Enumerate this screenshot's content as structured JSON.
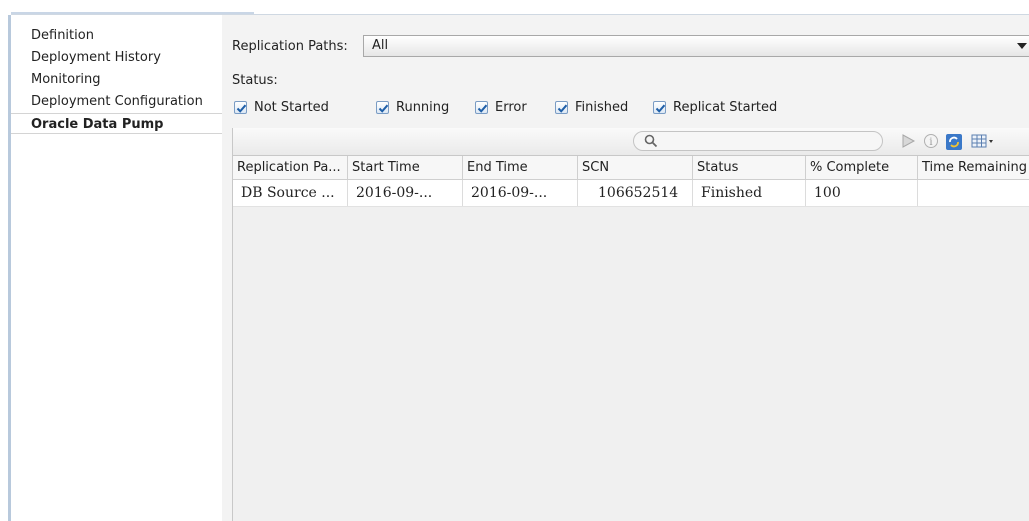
{
  "sidebar": {
    "items": [
      {
        "label": "Definition"
      },
      {
        "label": "Deployment History"
      },
      {
        "label": "Monitoring"
      },
      {
        "label": "Deployment Configuration"
      },
      {
        "label": "Oracle Data Pump",
        "selected": true
      }
    ]
  },
  "filters": {
    "replication_paths_label": "Replication Paths:",
    "replication_paths_value": "All",
    "status_label": "Status:",
    "status_checks": [
      {
        "label": "Not Started",
        "checked": true
      },
      {
        "label": "Running",
        "checked": true
      },
      {
        "label": "Error",
        "checked": true
      },
      {
        "label": "Finished",
        "checked": true
      },
      {
        "label": "Replicat Started",
        "checked": true
      }
    ]
  },
  "toolbar": {
    "icons": [
      "search-icon",
      "run-icon",
      "info-icon",
      "refresh-icon",
      "columns-icon"
    ]
  },
  "table": {
    "columns": [
      "Replication Pa...",
      "Start Time",
      "End Time",
      "SCN",
      "Status",
      "% Complete",
      "Time Remaining"
    ],
    "rows": [
      [
        "DB Source ...",
        "2016-09-...",
        "2016-09-...",
        "106652514",
        "Finished",
        "100",
        ""
      ]
    ]
  },
  "colors": {
    "accent": "#1f5fa8",
    "panel_bg": "#f3f3f3",
    "border": "#c8c8c8"
  }
}
